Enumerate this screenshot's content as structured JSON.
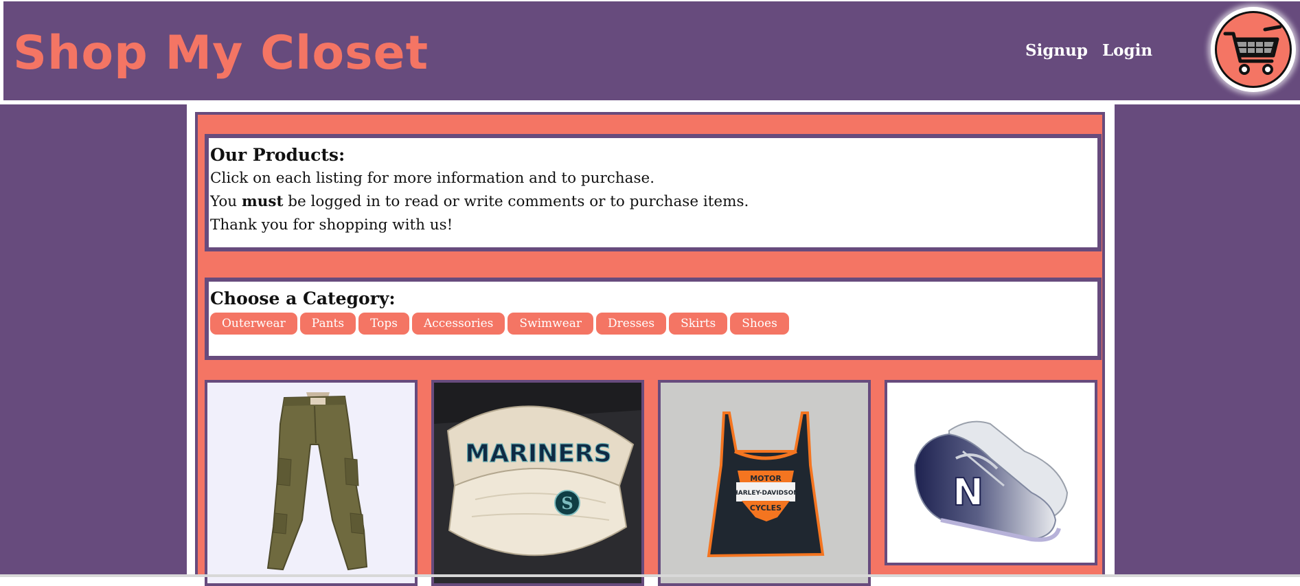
{
  "header": {
    "brand": "Shop My Closet",
    "nav": {
      "signup": "Signup",
      "login": "Login"
    },
    "cart_icon": "shopping-cart-icon"
  },
  "colors": {
    "primary_purple": "#674b7d",
    "accent_coral": "#f47564",
    "content_bg": "#ffffff"
  },
  "intro": {
    "heading": "Our Products:",
    "line1": "Click on each listing for more information and to purchase.",
    "line2_pre": "You ",
    "line2_strong": "must",
    "line2_post": " be logged in to read or write comments or to purchase items.",
    "line3": "Thank you for shopping with us!"
  },
  "categories": {
    "heading": "Choose a Category:",
    "items": [
      "Outerwear",
      "Pants",
      "Tops",
      "Accessories",
      "Swimwear",
      "Dresses",
      "Skirts",
      "Shoes"
    ]
  },
  "products": [
    {
      "image": "olive cargo pants"
    },
    {
      "image": "Mariners visor cap",
      "cap_text": "MARINERS",
      "logo_letter": "S"
    },
    {
      "image": "Harley-Davidson tank top",
      "text1": "MOTOR",
      "text2": "HARLEY-DAVIDSON",
      "text3": "CYCLES"
    },
    {
      "image": "New Balance sneakers",
      "letter": "N"
    }
  ]
}
